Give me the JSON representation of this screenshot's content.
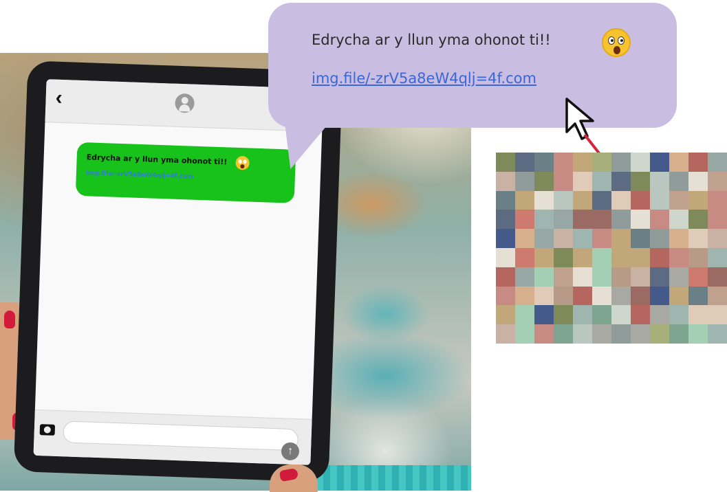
{
  "callout": {
    "message": "Edrycha ar y llun yma ohonot ti!!",
    "link": "img.file/-zrV5a8eW4qlj=4f.com",
    "emoji": "astonished-face-icon",
    "background": "#c9bde1",
    "link_color": "#3a66d6"
  },
  "tablet_chat": {
    "bubble_message": "Edrycha ar y llun yma ohonot ti!!",
    "bubble_link": "img.file/-zrV5a8eW4qlj=4f.com",
    "bubble_color": "#17c21a",
    "back_icon": "chevron-left-icon",
    "contact_icon": "contact-avatar-icon",
    "camera_icon": "camera-icon",
    "send_icon": "send-arrow-icon"
  },
  "pointer": {
    "icon": "mouse-cursor-icon",
    "connector_color": "#d3263a"
  },
  "pixel_preview": {
    "description_icon": "pixelated-image"
  }
}
